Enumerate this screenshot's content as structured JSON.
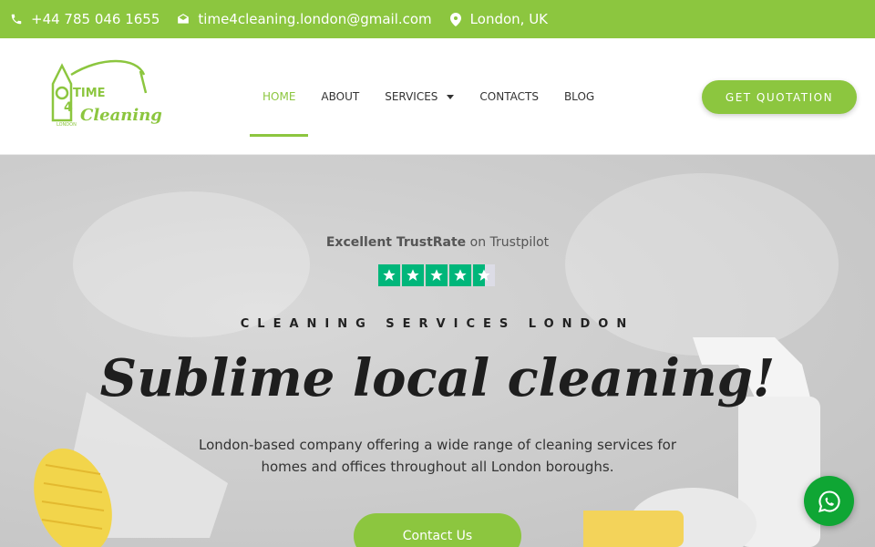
{
  "topbar": {
    "phone": "+44 785 046 1655",
    "email": "time4cleaning.london@gmail.com",
    "location": "London, UK",
    "phone_icon": "phone-icon",
    "email_icon": "envelope-icon",
    "location_icon": "map-pin-icon"
  },
  "brand": {
    "logo_icon": "time4cleaning-logo",
    "logo_text_1": "TIME",
    "logo_text_2": "Cleaning",
    "logo_text_small": "LONDON",
    "accent": "#8cc63f"
  },
  "nav": {
    "items": [
      {
        "label": "HOME"
      },
      {
        "label": "ABOUT"
      },
      {
        "label": "SERVICES"
      },
      {
        "label": "CONTACTS"
      },
      {
        "label": "BLOG"
      }
    ]
  },
  "header": {
    "quote_label": "GET QUOTATION"
  },
  "hero": {
    "trust_bold": "Excellent TrustRate",
    "trust_rest": " on Trustpilot",
    "rating": 4.5,
    "kicker": "CLEANING SERVICES LONDON",
    "headline": "Sublime local cleaning!",
    "description_line1": "London-based company offering a wide range of cleaning services for",
    "description_line2": "homes and offices throughout all London boroughs.",
    "cta_label": "Contact Us"
  },
  "floating": {
    "whatsapp_icon": "whatsapp-icon",
    "whatsapp_color": "#0fa634"
  }
}
